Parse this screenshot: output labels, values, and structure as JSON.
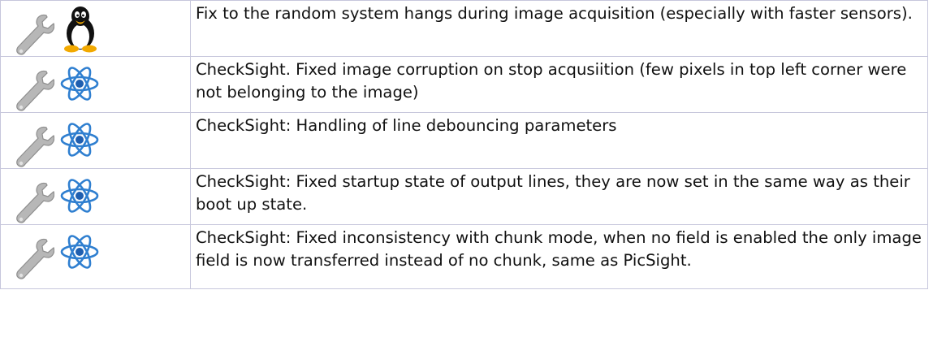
{
  "rows": [
    {
      "type_icon": "wrench-icon",
      "platform_icon": "linux-tux-icon",
      "text": "Fix to the random system hangs during image acquisition (especially with faster sensors)."
    },
    {
      "type_icon": "wrench-icon",
      "platform_icon": "atom-icon",
      "text": "CheckSight. Fixed image corruption on stop acqusiition (few pixels in top left corner were not belonging to the image)"
    },
    {
      "type_icon": "wrench-icon",
      "platform_icon": "atom-icon",
      "text": "CheckSight: Handling of line debouncing parameters"
    },
    {
      "type_icon": "wrench-icon",
      "platform_icon": "atom-icon",
      "text": "CheckSight: Fixed startup state of output lines, they are now set in the same way as their boot up state."
    },
    {
      "type_icon": "wrench-icon",
      "platform_icon": "atom-icon",
      "text": "CheckSight: Fixed inconsistency with chunk mode, when no field is enabled the only image field is now transferred instead of no chunk, same as PicSight."
    }
  ],
  "colors": {
    "border": "#c7c7dc",
    "atom_blue": "#2f7fd0",
    "wrench_gray": "#a8a8a8"
  }
}
